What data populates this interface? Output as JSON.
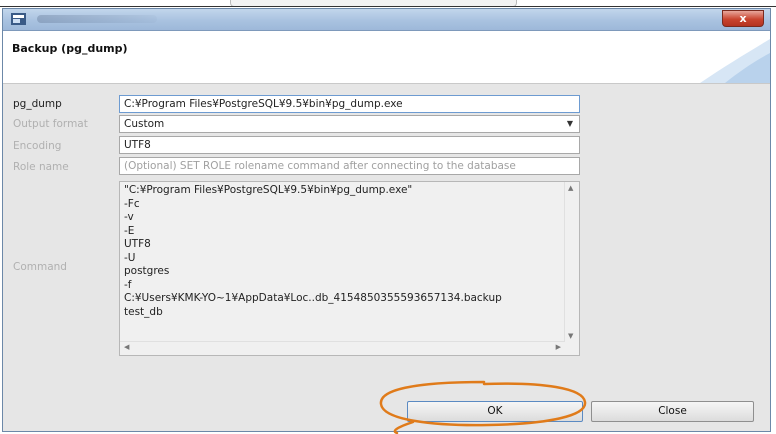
{
  "dialog": {
    "title": "Backup (pg_dump)",
    "close_glyph": "x"
  },
  "form": {
    "pg_dump_label": "pg_dump",
    "pg_dump_value": "C:¥Program Files¥PostgreSQL¥9.5¥bin¥pg_dump.exe",
    "output_format_label": "Output format",
    "output_format_value": "Custom",
    "encoding_label": "Encoding",
    "encoding_value": "UTF8",
    "role_name_label": "Role name",
    "role_name_placeholder": "(Optional) SET ROLE rolename command after connecting to the database",
    "command_label": "Command",
    "command_lines": [
      "\"C:¥Program Files¥PostgreSQL¥9.5¥bin¥pg_dump.exe\"",
      "-Fc",
      "-v",
      "-E",
      "UTF8",
      "-U",
      "postgres",
      "-f",
      "C:¥Users¥KMK-YO~1¥AppData¥Loc..db_4154850355593657134.backup",
      "test_db"
    ]
  },
  "buttons": {
    "ok_label": "OK",
    "close_label": "Close"
  },
  "colors": {
    "highlight_ring": "#e07b1a",
    "window_border": "#6c88a8",
    "close_button": "#c9442f"
  }
}
